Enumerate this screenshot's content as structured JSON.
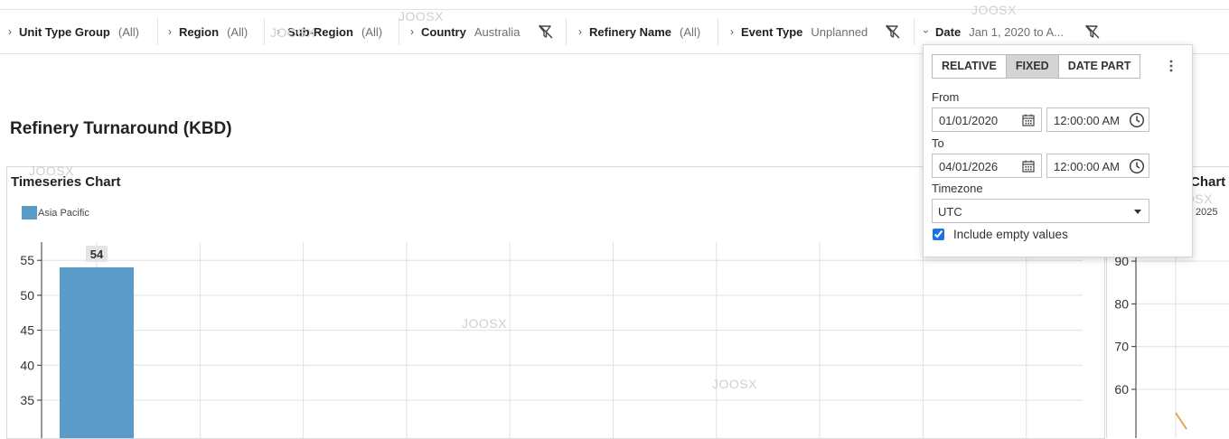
{
  "filters": [
    {
      "name": "Unit Type Group",
      "value": "(All)",
      "expanded": false,
      "filtered": false
    },
    {
      "name": "Region",
      "value": "(All)",
      "expanded": false,
      "filtered": false
    },
    {
      "name": "Sub-Region",
      "value": "(All)",
      "expanded": false,
      "filtered": false
    },
    {
      "name": "Country",
      "value": "Australia",
      "expanded": false,
      "filtered": true
    },
    {
      "name": "Refinery Name",
      "value": "(All)",
      "expanded": false,
      "filtered": false
    },
    {
      "name": "Event Type",
      "value": "Unplanned",
      "expanded": false,
      "filtered": true
    },
    {
      "name": "Date",
      "value": "Jan 1, 2020 to A...",
      "expanded": true,
      "filtered": true
    }
  ],
  "watermark": "JOOSX",
  "page": {
    "title": "Refinery Turnaround (KBD)"
  },
  "chart": {
    "title": "Timeseries Chart",
    "legend": "Asia Pacific",
    "color": "#5a9bca"
  },
  "chart_data": {
    "type": "bar",
    "title": "Timeseries Chart",
    "series": [
      {
        "name": "Asia Pacific",
        "values": [
          54
        ]
      }
    ],
    "data_labels": [
      "54"
    ],
    "yticks": [
      35,
      40,
      45,
      50,
      55
    ],
    "ylim": [
      31,
      56.5
    ],
    "grid": true,
    "legend_position": "top-left"
  },
  "chart2": {
    "title": "Chart",
    "legend_fragment": "2025",
    "yticks": [
      60,
      70,
      80,
      90
    ]
  },
  "date_popover": {
    "tabs": [
      "RELATIVE",
      "FIXED",
      "DATE PART"
    ],
    "active_tab": "FIXED",
    "from_label": "From",
    "from_date": "01/01/2020",
    "from_time": "12:00:00 AM",
    "to_label": "To",
    "to_date": "04/01/2026",
    "to_time": "12:00:00 AM",
    "timezone_label": "Timezone",
    "timezone": "UTC",
    "include_empty_label": "Include empty values",
    "include_empty": true
  }
}
